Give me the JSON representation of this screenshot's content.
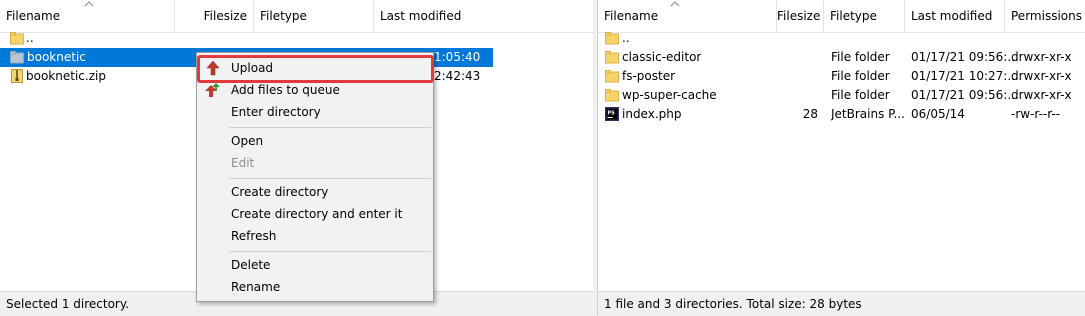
{
  "colors": {
    "accent": "#0078d7",
    "highlight": "#e03a3a",
    "folder": "#f7d46b",
    "up_arrow": "#c0392b"
  },
  "left": {
    "headers": [
      "Filename",
      "Filesize",
      "Filetype",
      "Last modified"
    ],
    "rows": [
      {
        "name": "..",
        "icon": "folder-icon",
        "modified": ""
      },
      {
        "name": "booknetic",
        "icon": "folder-icon",
        "modified": "1:05:40",
        "selected": true
      },
      {
        "name": "booknetic.zip",
        "icon": "zip-file-icon",
        "modified": "2:42:43"
      }
    ],
    "status": "Selected 1 directory."
  },
  "right": {
    "headers": [
      "Filename",
      "Filesize",
      "Filetype",
      "Last modified",
      "Permissions"
    ],
    "rows": [
      {
        "name": "..",
        "size": "",
        "type": "",
        "modified": "",
        "perm": ""
      },
      {
        "name": "classic-editor",
        "size": "",
        "type": "File folder",
        "modified": "01/17/21 09:56:...",
        "perm": "drwxr-xr-x"
      },
      {
        "name": "fs-poster",
        "size": "",
        "type": "File folder",
        "modified": "01/17/21 10:27:...",
        "perm": "drwxr-xr-x"
      },
      {
        "name": "wp-super-cache",
        "size": "",
        "type": "File folder",
        "modified": "01/17/21 09:56:...",
        "perm": "drwxr-xr-x"
      },
      {
        "name": "index.php",
        "size": "28",
        "type": "JetBrains P...",
        "modified": "06/05/14",
        "perm": "-rw-r--r--"
      }
    ],
    "status": "1 file and 3 directories. Total size: 28 bytes"
  },
  "menu": {
    "upload": "Upload",
    "add_queue": "Add files to queue",
    "enter_dir": "Enter directory",
    "open": "Open",
    "edit": "Edit",
    "create_dir": "Create directory",
    "create_dir_enter": "Create directory and enter it",
    "refresh": "Refresh",
    "delete": "Delete",
    "rename": "Rename"
  }
}
